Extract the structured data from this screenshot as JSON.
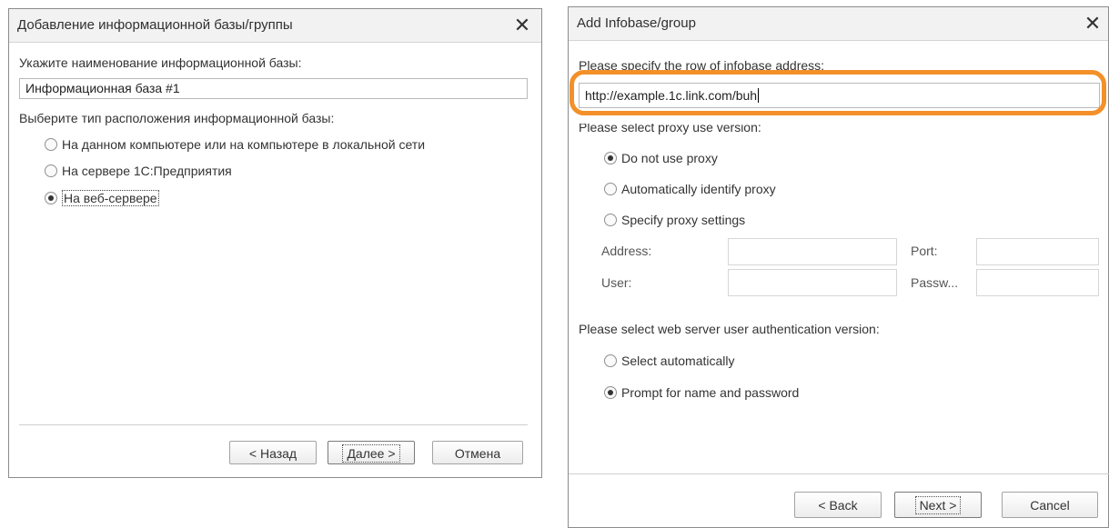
{
  "left_dialog": {
    "title": "Добавление информационной базы/группы",
    "close_label": "✕",
    "name_prompt": "Укажите наименование информационной базы:",
    "name_value": "Информационная база #1",
    "location_prompt": "Выберите тип расположения информационной базы:",
    "options": [
      {
        "label": "На данном компьютере или на компьютере в локальной сети",
        "checked": false
      },
      {
        "label": "На сервере 1С:Предприятия",
        "checked": false
      },
      {
        "label": "На веб-сервере",
        "checked": true
      }
    ],
    "buttons": {
      "back": "< Назад",
      "next": "Далее >",
      "cancel": "Отмена"
    }
  },
  "right_dialog": {
    "title": "Add Infobase/group",
    "close_label": "✕",
    "address_prompt": "Please specify the row of infobase address:",
    "address_value": "http://example.1c.link.com/buh",
    "proxy_prompt": "Please select proxy use version:",
    "proxy_options": [
      {
        "label": "Do not use proxy",
        "checked": true
      },
      {
        "label": "Automatically identify proxy",
        "checked": false
      },
      {
        "label": "Specify proxy settings",
        "checked": false
      }
    ],
    "proxy_fields": {
      "address": "Address:",
      "port": "Port:",
      "user": "User:",
      "password": "Passw..."
    },
    "auth_prompt": "Please select web server user authentication version:",
    "auth_options": [
      {
        "label": "Select automatically",
        "checked": false
      },
      {
        "label": "Prompt for name and password",
        "checked": true
      }
    ],
    "buttons": {
      "back": "< Back",
      "next": "Next >",
      "cancel": "Cancel"
    }
  },
  "colors": {
    "highlight": "#f39029",
    "titlebar": "#f2f2f2"
  }
}
